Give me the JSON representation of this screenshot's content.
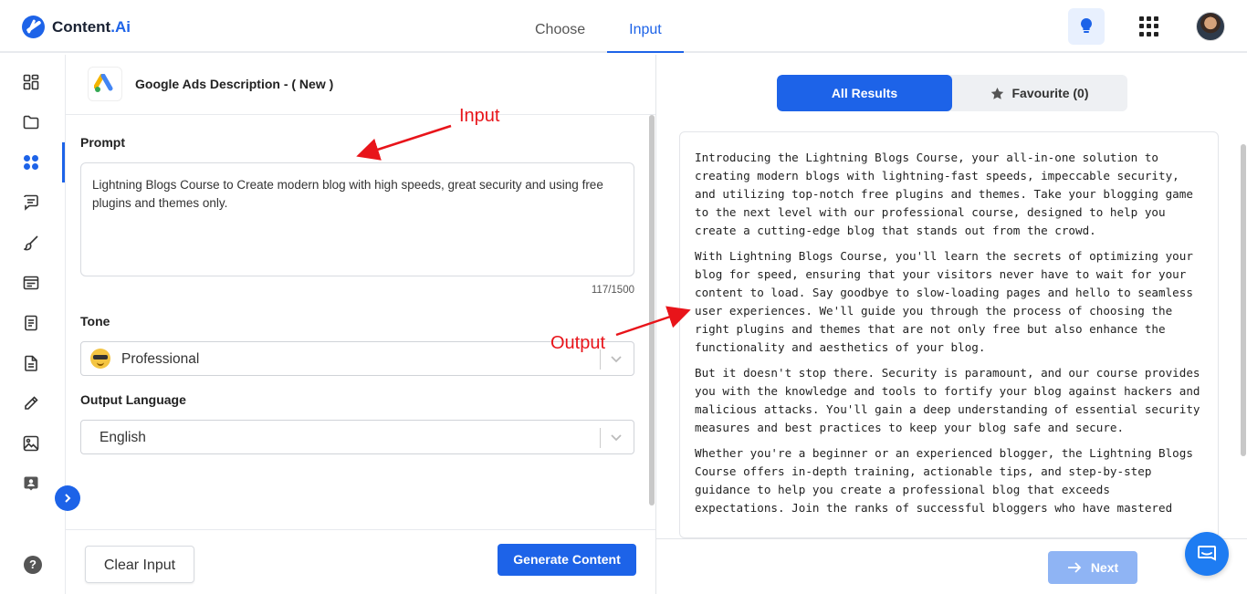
{
  "header": {
    "logo": {
      "name": "Content",
      "suffix": ".Ai"
    },
    "tabs": [
      {
        "label": "Choose",
        "active": false
      },
      {
        "label": "Input",
        "active": true
      }
    ]
  },
  "sidebar": {
    "items": [
      {
        "icon": "dashboard-icon"
      },
      {
        "icon": "folder-icon"
      },
      {
        "icon": "apps-grid-icon",
        "active": true
      },
      {
        "icon": "chat-icon"
      },
      {
        "icon": "brush-icon"
      },
      {
        "icon": "card-icon"
      },
      {
        "icon": "document-list-icon"
      },
      {
        "icon": "document-icon"
      },
      {
        "icon": "pencil-icon"
      },
      {
        "icon": "image-icon"
      },
      {
        "icon": "user-badge-icon"
      }
    ],
    "help_label": "?"
  },
  "template": {
    "title": "Google Ads Description - ( New )"
  },
  "form": {
    "prompt_label": "Prompt",
    "prompt_value": "Lightning Blogs Course to Create modern blog with high speeds, great security and using free plugins and themes only.",
    "char_count": "117/1500",
    "tone_label": "Tone",
    "tone_value": "Professional",
    "language_label": "Output Language",
    "language_value": "English",
    "clear_label": "Clear Input",
    "generate_label": "Generate Content"
  },
  "results": {
    "tabs": [
      {
        "label": "All Results",
        "active": true
      },
      {
        "label": "Favourite (0)",
        "active": false
      }
    ],
    "paragraphs": [
      "Introducing the Lightning Blogs Course, your all-in-one solution to creating modern blogs with lightning-fast speeds, impeccable security, and utilizing top-notch free plugins and themes. Take your blogging game to the next level with our professional course, designed to help you create a cutting-edge blog that stands out from the crowd.",
      "With Lightning Blogs Course, you'll learn the secrets of optimizing your blog for speed, ensuring that your visitors never have to wait for your content to load. Say goodbye to slow-loading pages and hello to seamless user experiences. We'll guide you through the process of choosing the right plugins and themes that are not only free but also enhance the functionality and aesthetics of your blog.",
      "But it doesn't stop there. Security is paramount, and our course provides you with the knowledge and tools to fortify your blog against hackers and malicious attacks. You'll gain a deep understanding of essential security measures and best practices to keep your blog safe and secure.",
      "Whether you're a beginner or an experienced blogger, the Lightning Blogs Course offers in-depth training, actionable tips, and step-by-step guidance to help you create a professional blog that exceeds expectations. Join the ranks of successful bloggers who have mastered"
    ],
    "next_label": "Next"
  },
  "annotations": {
    "input_label": "Input",
    "output_label": "Output"
  },
  "colors": {
    "accent": "#1d63e8",
    "annotation": "#e8141a"
  }
}
